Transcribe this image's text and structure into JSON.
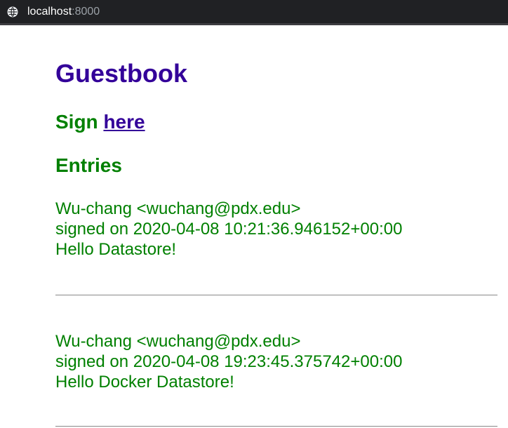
{
  "browser": {
    "host": "localhost",
    "port": ":8000"
  },
  "page": {
    "title": "Guestbook",
    "sign_prefix": "Sign",
    "sign_link": "here",
    "entries_heading": "Entries"
  },
  "entries": [
    {
      "author": "Wu-chang <wuchang@pdx.edu>",
      "signed": "signed on 2020-04-08 10:21:36.946152+00:00",
      "message": "Hello Datastore!"
    },
    {
      "author": "Wu-chang <wuchang@pdx.edu>",
      "signed": "signed on 2020-04-08 19:23:45.375742+00:00",
      "message": "Hello Docker Datastore!"
    }
  ],
  "colors": {
    "title": "#330099",
    "heading_green": "#008000",
    "link": "#330099",
    "browser_bar": "#202124"
  }
}
